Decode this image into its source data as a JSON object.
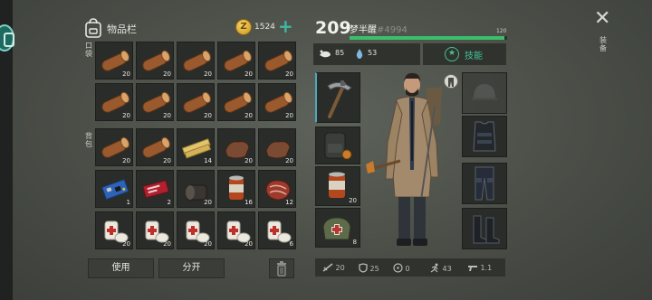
{
  "inventory": {
    "title": "物品栏",
    "pockets_label": "口袋",
    "backpack_label": "背包",
    "coins": "1524",
    "plus": "+"
  },
  "slots": [
    {
      "item": "log",
      "qty": "20"
    },
    {
      "item": "log",
      "qty": "20"
    },
    {
      "item": "log",
      "qty": "20"
    },
    {
      "item": "log",
      "qty": "20"
    },
    {
      "item": "log",
      "qty": "20"
    },
    {
      "item": "log",
      "qty": "20"
    },
    {
      "item": "log",
      "qty": "20"
    },
    {
      "item": "log",
      "qty": "20"
    },
    {
      "item": "log",
      "qty": "20"
    },
    {
      "item": "log",
      "qty": "20"
    },
    {
      "item": "log",
      "qty": "20"
    },
    {
      "item": "log",
      "qty": "20"
    },
    {
      "item": "plank",
      "qty": "14"
    },
    {
      "item": "leather",
      "qty": "20"
    },
    {
      "item": "leather",
      "qty": "20"
    },
    {
      "item": "circuit-board",
      "qty": "1"
    },
    {
      "item": "ticket",
      "qty": "2"
    },
    {
      "item": "stump",
      "qty": "20"
    },
    {
      "item": "canned-food",
      "qty": "16"
    },
    {
      "item": "raw-meat",
      "qty": "12"
    },
    {
      "item": "bandage",
      "qty": "20"
    },
    {
      "item": "bandage",
      "qty": "20"
    },
    {
      "item": "bandage",
      "qty": "20"
    },
    {
      "item": "bandage",
      "qty": "20"
    },
    {
      "item": "bandage",
      "qty": "6"
    }
  ],
  "buttons": {
    "use": "使用",
    "split": "分开"
  },
  "player": {
    "level": "209",
    "name": "梦半醒",
    "id": "#4994",
    "xp_label": "120",
    "xp_fraction": 0.98,
    "food": "85",
    "water": "53",
    "skills_label": "技能"
  },
  "gear_label": "装备",
  "equipment": {
    "weapon": "pickaxe",
    "backpack": "backpack",
    "food_qty": "20",
    "med_qty": "8"
  },
  "armor": [
    "helmet-empty",
    "vest",
    "pants",
    "boots"
  ],
  "stats": {
    "attack": "20",
    "defense": "25",
    "radiation": "0",
    "speed": "43",
    "gun": "1.1"
  },
  "colors": {
    "accent": "#3fb8a2",
    "xp": "#3ac06a",
    "skill": "#45c39b",
    "background": "#4a4e47",
    "slot": "#2a2c29"
  }
}
